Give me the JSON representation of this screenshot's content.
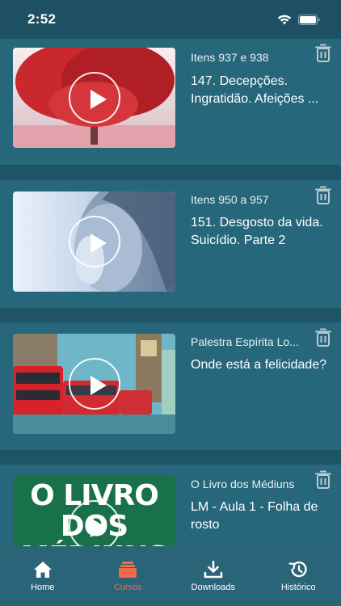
{
  "status": {
    "time": "2:52"
  },
  "cards": [
    {
      "subtitle": "Itens 937 e 938",
      "title": "147. Decepções. Ingratidão. Afeições ..."
    },
    {
      "subtitle": "Itens 950 a 957",
      "title": "151. Desgosto da vida. Suicídio. Parte 2"
    },
    {
      "subtitle": "Palestra Espírita Lo...",
      "title": "Onde está a felicidade?"
    },
    {
      "subtitle": "O Livro dos Médiuns",
      "title": "LM - Aula 1 - Folha de rosto",
      "thumb_text": "O LIVRO DOS MÉDIUNS"
    }
  ],
  "tabs": [
    {
      "label": "Home",
      "icon": "home-icon"
    },
    {
      "label": "Cursos",
      "icon": "courses-icon",
      "active": true
    },
    {
      "label": "Downloads",
      "icon": "download-icon"
    },
    {
      "label": "Histórico",
      "icon": "history-icon"
    }
  ],
  "colors": {
    "background": "#1f5466",
    "card": "#26677c",
    "tabbar": "#2a6479",
    "accent": "#f26b4b"
  }
}
